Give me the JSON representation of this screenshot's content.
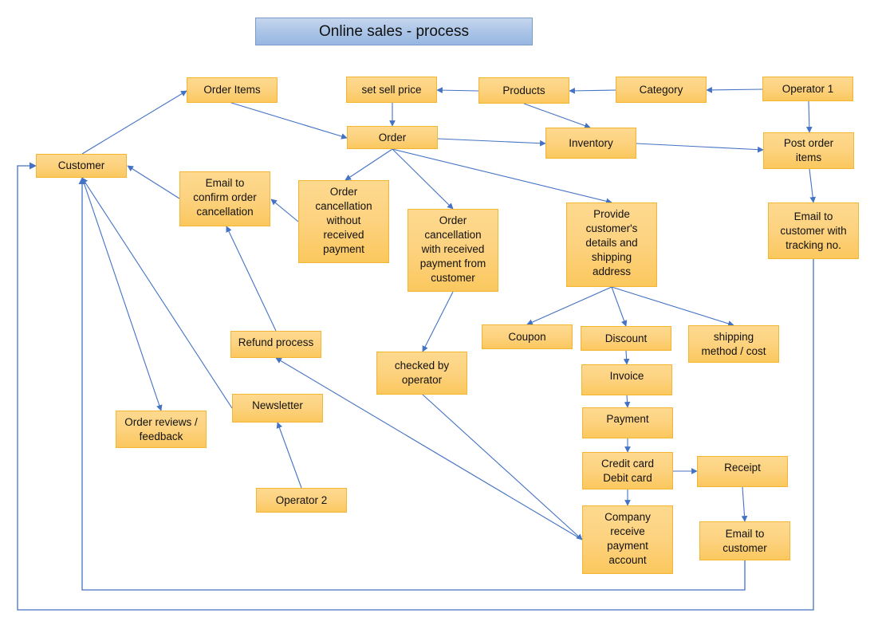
{
  "title": "Online sales - process",
  "colors": {
    "node_fill": "#fdd27f",
    "node_border": "#f2b632",
    "title_fill": "#a9c3e6",
    "edge": "#4472c4"
  },
  "nodes": {
    "customer": "Customer",
    "order_items": "Order Items",
    "set_sell_price": "set sell price",
    "products": "Products",
    "category": "Category",
    "operator_1": "Operator 1",
    "order": "Order",
    "inventory": "Inventory",
    "post_order_items": "Post order\nitems",
    "email_tracking": "Email to\ncustomer with\ntracking no.",
    "email_confirm_cancel": "Email to\nconfirm order\ncancellation",
    "cancel_without_payment": "Order\ncancellation\nwithout\nreceived\npayment",
    "cancel_with_payment": "Order\ncancellation\nwith received\npayment from\ncustomer",
    "provide_details": "Provide\ncustomer's\ndetails and\nshipping\naddress",
    "coupon": "Coupon",
    "discount": "Discount",
    "shipping_method": "shipping\nmethod / cost",
    "refund_process": "Refund process",
    "checked_by_operator": "checked by\noperator",
    "invoice": "Invoice",
    "payment": "Payment",
    "credit_debit": "Credit card\nDebit card",
    "receipt": "Receipt",
    "order_reviews": "Order reviews /\nfeedback",
    "newsletter": "Newsletter",
    "operator_2": "Operator 2",
    "company_receive": "Company\nreceive\npayment\naccount",
    "email_customer": "Email to\ncustomer"
  },
  "edges": [
    {
      "from": "customer",
      "to": "order_items"
    },
    {
      "from": "order_items",
      "to": "order"
    },
    {
      "from": "products",
      "to": "set_sell_price"
    },
    {
      "from": "category",
      "to": "products"
    },
    {
      "from": "operator_1",
      "to": "category"
    },
    {
      "from": "set_sell_price",
      "to": "order"
    },
    {
      "from": "products",
      "to": "inventory"
    },
    {
      "from": "order",
      "to": "inventory"
    },
    {
      "from": "inventory",
      "to": "post_order_items"
    },
    {
      "from": "operator_1",
      "to": "post_order_items"
    },
    {
      "from": "post_order_items",
      "to": "email_tracking"
    },
    {
      "from": "email_tracking",
      "to": "customer",
      "routing": "orthogonal-outer"
    },
    {
      "from": "order",
      "to": "cancel_without_payment"
    },
    {
      "from": "order",
      "to": "cancel_with_payment"
    },
    {
      "from": "order",
      "to": "provide_details"
    },
    {
      "from": "cancel_without_payment",
      "to": "email_confirm_cancel"
    },
    {
      "from": "email_confirm_cancel",
      "to": "customer"
    },
    {
      "from": "cancel_with_payment",
      "to": "checked_by_operator"
    },
    {
      "from": "checked_by_operator",
      "to": "company_receive"
    },
    {
      "from": "company_receive",
      "to": "refund_process"
    },
    {
      "from": "refund_process",
      "to": "email_confirm_cancel"
    },
    {
      "from": "provide_details",
      "to": "coupon"
    },
    {
      "from": "provide_details",
      "to": "discount"
    },
    {
      "from": "provide_details",
      "to": "shipping_method"
    },
    {
      "from": "discount",
      "to": "invoice"
    },
    {
      "from": "invoice",
      "to": "payment"
    },
    {
      "from": "payment",
      "to": "credit_debit"
    },
    {
      "from": "credit_debit",
      "to": "receipt"
    },
    {
      "from": "credit_debit",
      "to": "company_receive"
    },
    {
      "from": "receipt",
      "to": "email_customer"
    },
    {
      "from": "email_customer",
      "to": "customer",
      "routing": "orthogonal-inner"
    },
    {
      "from": "customer",
      "to": "order_reviews"
    },
    {
      "from": "newsletter",
      "to": "customer"
    },
    {
      "from": "operator_2",
      "to": "newsletter"
    }
  ]
}
